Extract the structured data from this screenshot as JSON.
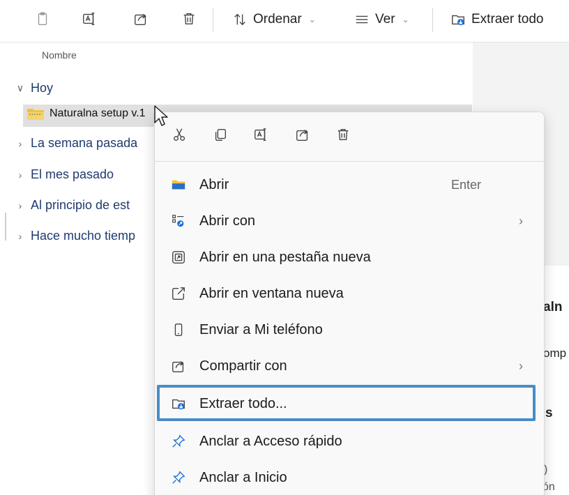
{
  "toolbar": {
    "icons": [
      "paste-icon",
      "rename-icon",
      "share-icon",
      "delete-icon"
    ],
    "sort_label": "Ordenar",
    "view_label": "Ver",
    "extract_label": "Extraer todo"
  },
  "list": {
    "column_header": "Nombre",
    "groups": [
      {
        "label": "Hoy",
        "expanded": true
      },
      {
        "label": "La semana pasada",
        "expanded": false
      },
      {
        "label": "El mes pasado",
        "expanded": false
      },
      {
        "label": "Al principio de est",
        "expanded": false
      },
      {
        "label": "Hace mucho tiemp",
        "expanded": false
      }
    ],
    "selected_file": "Naturalna setup v.1"
  },
  "right_pane": {
    "fragments": [
      "aln",
      "omp",
      "s",
      ")",
      "ón"
    ]
  },
  "context_menu": {
    "quick_actions": [
      "cut-icon",
      "copy-icon",
      "rename-icon",
      "share-icon",
      "delete-icon"
    ],
    "items": [
      {
        "label": "Abrir",
        "accel": "Enter",
        "icon": "folder-icon",
        "submenu": false
      },
      {
        "label": "Abrir con",
        "accel": "",
        "icon": "open-with-icon",
        "submenu": true
      },
      {
        "label": "Abrir en una pestaña nueva",
        "accel": "",
        "icon": "new-tab-icon",
        "submenu": false
      },
      {
        "label": "Abrir en ventana nueva",
        "accel": "",
        "icon": "new-window-icon",
        "submenu": false
      },
      {
        "label": "Enviar a Mi teléfono",
        "accel": "",
        "icon": "phone-icon",
        "submenu": false
      },
      {
        "label": "Compartir con",
        "accel": "",
        "icon": "share-icon",
        "submenu": true
      },
      {
        "label": "Extraer todo...",
        "accel": "",
        "icon": "extract-icon",
        "submenu": false,
        "highlighted": true
      },
      {
        "label": "Anclar a Acceso rápido",
        "accel": "",
        "icon": "pin-icon",
        "submenu": false
      },
      {
        "label": "Anclar a Inicio",
        "accel": "",
        "icon": "pin-icon",
        "submenu": false
      }
    ],
    "submenu_glyph": "›"
  },
  "colors": {
    "highlight_border": "#4a8cc7",
    "selected_row": "#e0e0e0",
    "group_text": "#1f3a6e",
    "folder_yellow": "#f2c23d",
    "extract_accent": "#1d6fd6"
  }
}
